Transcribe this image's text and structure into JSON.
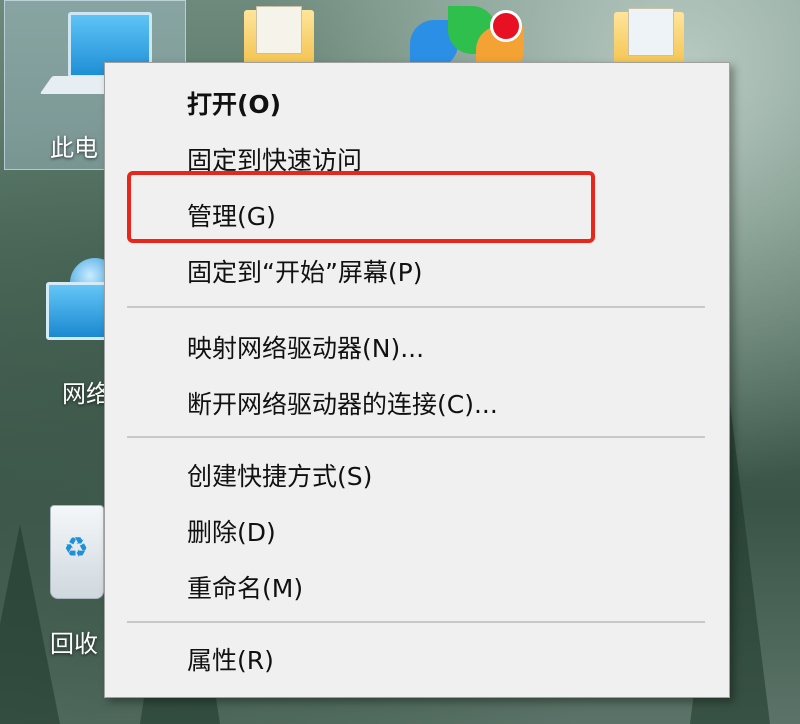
{
  "desktop": {
    "icons": [
      {
        "label": "此电"
      },
      {
        "label": "网络"
      },
      {
        "label": "回收"
      }
    ]
  },
  "context_menu": {
    "items": [
      {
        "label": "打开(O)",
        "default": true
      },
      {
        "label": "固定到快速访问"
      },
      {
        "label": "管理(G)",
        "highlighted": true
      },
      {
        "label": "固定到“开始”屏幕(P)"
      },
      {
        "label": "映射网络驱动器(N)..."
      },
      {
        "label": "断开网络驱动器的连接(C)..."
      },
      {
        "label": "创建快捷方式(S)"
      },
      {
        "label": "删除(D)"
      },
      {
        "label": "重命名(M)"
      },
      {
        "label": "属性(R)"
      }
    ],
    "highlight_color": "#e8261c"
  },
  "colors": {
    "menu_bg": "#f0f0f0",
    "badge": "#e81123"
  }
}
